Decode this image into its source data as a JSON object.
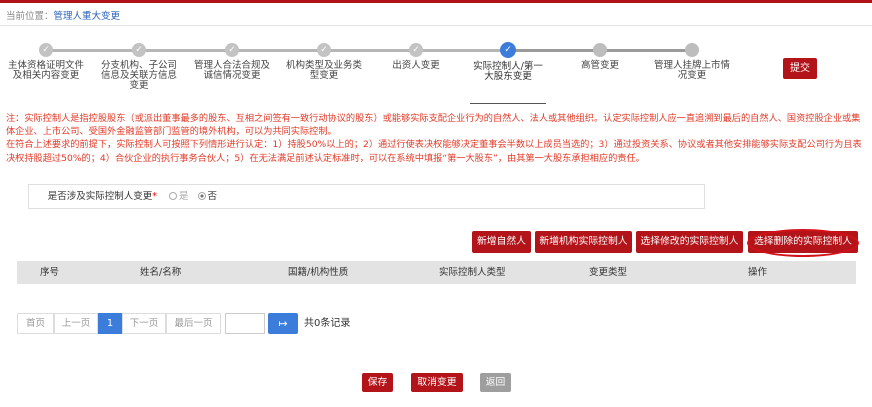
{
  "breadcrumb": {
    "prefix": "当前位置：",
    "current": "管理人重大变更"
  },
  "steps": [
    {
      "label": "主体资格证明文件及相关内容变更",
      "state": "done"
    },
    {
      "label": "分支机构、子公司信息及关联方信息变更",
      "state": "done"
    },
    {
      "label": "管理人合法合规及诚信情况变更",
      "state": "done"
    },
    {
      "label": "机构类型及业务类型变更",
      "state": "done"
    },
    {
      "label": "出资人变更",
      "state": "done"
    },
    {
      "label": "实际控制人/第一大股东变更",
      "state": "active"
    },
    {
      "label": "高管变更",
      "state": "pending"
    },
    {
      "label": "管理人挂牌上市情况变更",
      "state": "pending"
    }
  ],
  "submit_label": "提交",
  "notes": {
    "line1": "注：实际控制人是指控股股东（或派出董事最多的股东、互相之间签有一致行动协议的股东）或能够实际支配企业行为的自然人、法人或其他组织。认定实际控制人应一直追溯到最后的自然人、国资控股企业或集体企业、上市公司、受国外金融监管部门监管的境外机构，可以为共同实际控制。",
    "line2": "在符合上述要求的前提下，实际控制人可按照下列情形进行认定：1）持股50%以上的；2）通过行使表决权能够决定董事会半数以上成员当选的；3）通过投资关系、协议或者其他安排能够实际支配公司行为且表决权持股超过50%的；4）合伙企业的执行事务合伙人；5）在无法满足前述认定标准时，可以在系统中填报“第一大股东”，由其第一大股东承担相应的责任。"
  },
  "form": {
    "label": "是否涉及实际控制人变更",
    "required_mark": "*",
    "options": [
      "是",
      "否"
    ],
    "selected": "否"
  },
  "actions": [
    "新增自然人",
    "新增机构实际控制人",
    "选择修改的实际控制人",
    "选择删除的实际控制人"
  ],
  "table": {
    "columns": [
      "序号",
      "姓名/名称",
      "国籍/机构性质",
      "实际控制人类型",
      "变更类型",
      "操作"
    ],
    "rows": []
  },
  "pager": {
    "first": "首页",
    "prev": "上一页",
    "current": "1",
    "next": "下一页",
    "last": "最后一页",
    "go_icon": "enter-arrow-icon",
    "total": "共0条记录"
  },
  "bottom": {
    "save": "保存",
    "cancel": "取消变更",
    "back": "返回"
  },
  "colors": {
    "brand_red": "#b2141a",
    "accent_blue": "#3c7ddc",
    "note_red": "#e23a28"
  }
}
